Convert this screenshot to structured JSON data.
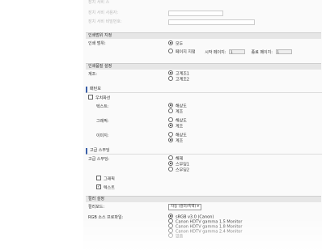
{
  "top": {
    "fields": [
      {
        "label": "장치 서비 사용자:",
        "value": ""
      },
      {
        "label": "장치 서비 비밀번호:",
        "value": ""
      }
    ]
  },
  "range_section": {
    "title": "인쇄범위 지정",
    "label": "인쇄 범위:",
    "options": [
      {
        "label": "모두",
        "selected": true
      },
      {
        "label": "페이지 지정",
        "selected": false
      }
    ],
    "start_label": "시작 페이지:",
    "start_value": "1",
    "end_label": "종료 페이지:",
    "end_value": "1"
  },
  "scan_section": {
    "title": "인쇄품질 설정",
    "label": "계조:",
    "options": [
      {
        "label": "고계조1",
        "selected": true
      },
      {
        "label": "고계조2",
        "selected": false
      }
    ]
  },
  "smoothing": {
    "title": "패턴보",
    "checkbox_label": "우치화선",
    "groups": [
      {
        "label": "텍스트:",
        "options": [
          {
            "label": "해상도",
            "selected": true
          },
          {
            "label": "계조",
            "selected": false
          }
        ]
      },
      {
        "label": "그래픽:",
        "options": [
          {
            "label": "해상도",
            "selected": false
          },
          {
            "label": "계조",
            "selected": true
          }
        ]
      },
      {
        "label": "이미지:",
        "options": [
          {
            "label": "해상도",
            "selected": false
          },
          {
            "label": "계조",
            "selected": true
          }
        ]
      }
    ]
  },
  "advanced": {
    "title": "고급 스무딩",
    "label": "고급 스무딩:",
    "options": [
      {
        "label": "해제",
        "selected": false
      },
      {
        "label": "스무딩1",
        "selected": true
      },
      {
        "label": "스무딩2",
        "selected": false
      }
    ],
    "checks": [
      {
        "label": "그래픽",
        "checked": false
      },
      {
        "label": "텍스트",
        "checked": true
      }
    ]
  },
  "color": {
    "title": "컬러 설정",
    "mode_label": "컬러모드:",
    "mode_value": "자동 (컬러/흑백)",
    "rgb_label": "RGB 소스 프로파일:",
    "rgb_options": [
      {
        "label": "sRGB v3.0 (Canon)",
        "selected": true
      },
      {
        "label": "Canon HDTV gamma 1.5 Monitor",
        "selected": false
      },
      {
        "label": "Canon HDTV gamma 1.8 Monitor",
        "selected": false
      },
      {
        "label": "Canon HDTV gamma 2.4 Monitor",
        "selected": false
      },
      {
        "label": "없음",
        "selected": false
      }
    ]
  }
}
